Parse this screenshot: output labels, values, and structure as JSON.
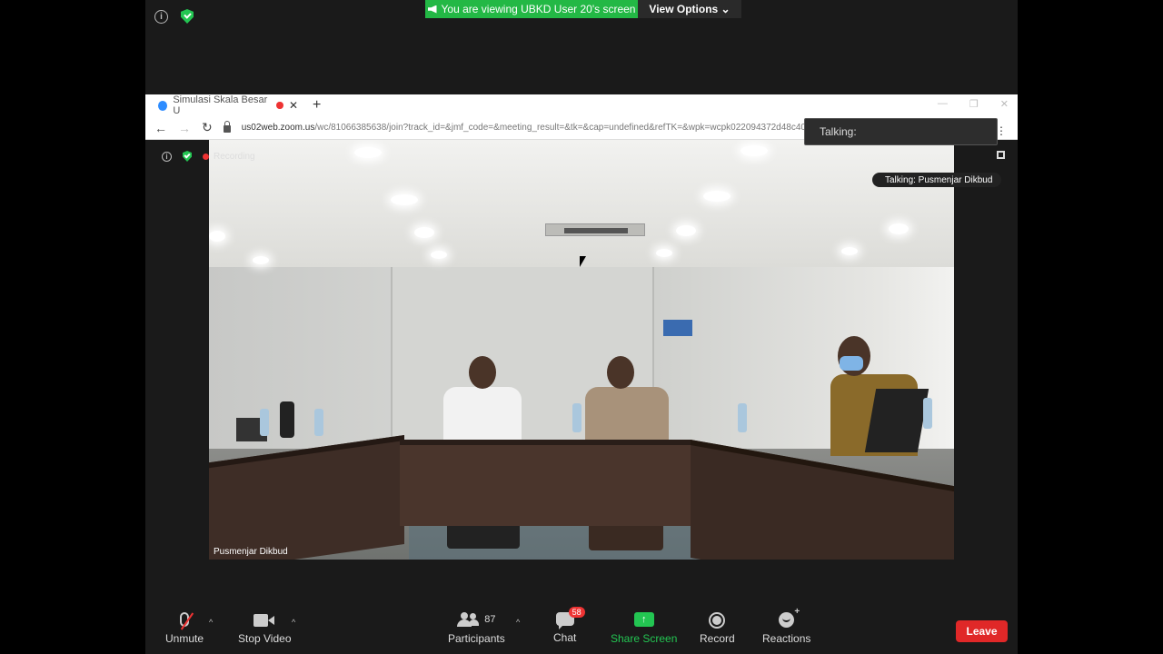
{
  "banner": {
    "viewing_text": "You are viewing UBKD User 20's screen",
    "view_options": "View Options ⌄"
  },
  "browser": {
    "tab_title": "Simulasi Skala Besar U",
    "url_host": "us02web.zoom.us",
    "url_path": "/wc/81066385638/join?track_id=&jmf_code=&meeting_result=&tk=&cap=undefined&refTK=&wpk=wcpk022094372d48c40f"
  },
  "talking_popup": "Talking:",
  "meeting": {
    "recording_label": "Recording",
    "talking_chip": "Talking: Pusmenjar Dikbud",
    "participant_name": "Pusmenjar Dikbud"
  },
  "toolbar": {
    "unmute": "Unmute",
    "stop_video": "Stop Video",
    "participants": "Participants",
    "participants_count": "87",
    "chat": "Chat",
    "chat_badge": "58",
    "share_screen": "Share Screen",
    "record": "Record",
    "reactions": "Reactions",
    "leave": "Leave"
  },
  "colors": {
    "share_green": "#23c552",
    "leave_red": "#e02828",
    "recording_red": "#ee3333"
  }
}
